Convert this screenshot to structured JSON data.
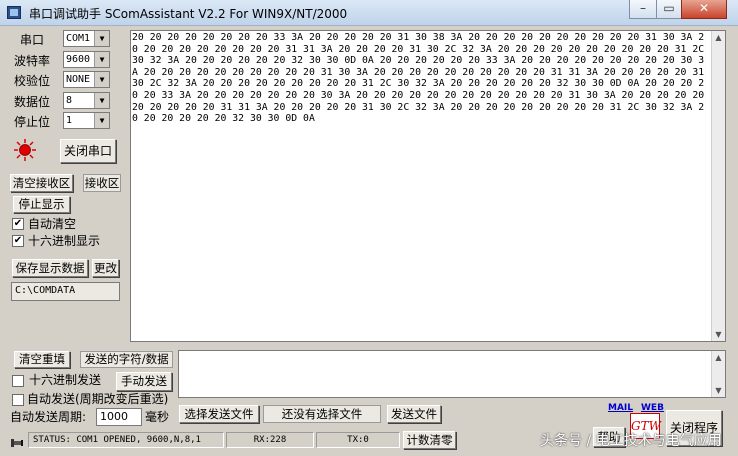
{
  "window": {
    "title": "串口调试助手 SComAssistant V2.2 For WIN9X/NT/2000",
    "minimize": "–",
    "maximize": "▭",
    "close": "✕"
  },
  "settings": {
    "port_label": "串口",
    "port_value": "COM1",
    "baud_label": "波特率",
    "baud_value": "9600",
    "parity_label": "校验位",
    "parity_value": "NONE",
    "databits_label": "数据位",
    "databits_value": "8",
    "stopbits_label": "停止位",
    "stopbits_value": "1",
    "close_port_button": "关闭串口"
  },
  "receive": {
    "clear_button": "清空接收区",
    "area_label": "接收区",
    "stop_display_button": "停止显示",
    "auto_clear_label": "自动清空",
    "auto_clear_checked": true,
    "hex_display_label": "十六进制显示",
    "hex_display_checked": true,
    "save_button": "保存显示数据",
    "change_button": "更改",
    "save_path": "C:\\COMDATA",
    "content": "20 20 20 20 20 20 20 20 33 3A 20 20 20 20 20 31 30 38 3A 20 20 20 20 20 20 20 20 20 20 31 30 3A 20 20 20 20 20 20 20 20 20 31 31 3A 20 20 20 20 31 30 2C 32 3A 20 20 20 20 20 20 20 20 20 20 31 2C 30 32 3A 20 20 20 20 20 20 32 30 30 0D 0A 20 20 20 20 20 20 33 3A 20 20 20 20 20 20 20 20 20 30 3A 20 20 20 20 20 20 20 20 20 20 31 30 3A 20 20 20 20 20 20 20 20 20 20 31 31 3A 20 20 20 20 20 31 30 2C 32 3A 20 20 20 20 20 20 20 20 20 31 2C 30 32 3A 20 20 20 20 20 20 32 30 30 0D 0A 20 20 20 20 20 33 3A 20 20 20 20 20 20 20 30 3A 20 20 20 20 20 20 20 20 20 20 20 20 31 30 3A 20 20 20 20 20 20 20 20 20 20 31 31 3A 20 20 20 20 20 31 30 2C 32 3A 20 20 20 20 20 20 20 20 20 31 2C 30 32 3A 20 20 20 20 20 20 32 30 30 0D 0A"
  },
  "send": {
    "clear_button": "清空重填",
    "area_label": "发送的字符/数据",
    "hex_send_label": "十六进制发送",
    "hex_send_checked": false,
    "manual_send_button": "手动发送",
    "auto_send_label": "自动发送(周期改变后重选)",
    "auto_send_checked": false,
    "period_label": "自动发送周期:",
    "period_value": "1000",
    "period_unit": "毫秒",
    "select_file_button": "选择发送文件",
    "no_file_text": "还没有选择文件",
    "send_file_button": "发送文件"
  },
  "footer": {
    "mail_link": "MAIL",
    "web_link": "WEB",
    "help_button": "帮助",
    "close_app_button": "关闭程序",
    "logo_text": "GTW"
  },
  "status": {
    "status_text": "STATUS: COM1 OPENED, 9600,N,8,1",
    "rx_text": "RX:228",
    "tx_text": "TX:0",
    "reset_counter_button": "计数清零"
  },
  "watermark": "头条号 / 电工技术与电气应用",
  "colors": {
    "window_bg": "#d4d0c8",
    "lamp": "#e00000",
    "link": "#0000cc"
  }
}
